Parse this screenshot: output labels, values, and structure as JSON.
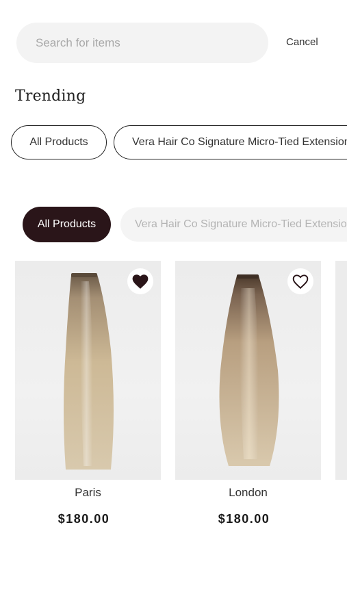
{
  "search": {
    "placeholder": "Search for items",
    "value": "",
    "cancel_label": "Cancel"
  },
  "trending": {
    "title": "Trending",
    "chips": [
      {
        "label": "All Products"
      },
      {
        "label": "Vera Hair Co Signature Micro-Tied Extensions"
      }
    ]
  },
  "filters": {
    "chips": [
      {
        "label": "All Products",
        "selected": true
      },
      {
        "label": "Vera Hair Co Signature Micro-Tied Extensions",
        "selected": false
      }
    ]
  },
  "products": [
    {
      "name": "Paris",
      "price": "$180.00",
      "favorited": true,
      "icon": "heart-filled-icon"
    },
    {
      "name": "London",
      "price": "$180.00",
      "favorited": false,
      "icon": "heart-outline-icon"
    }
  ],
  "colors": {
    "accent": "#2a1519",
    "chip_muted_bg": "#f4f4f4",
    "search_bg": "#f3f3f3"
  }
}
